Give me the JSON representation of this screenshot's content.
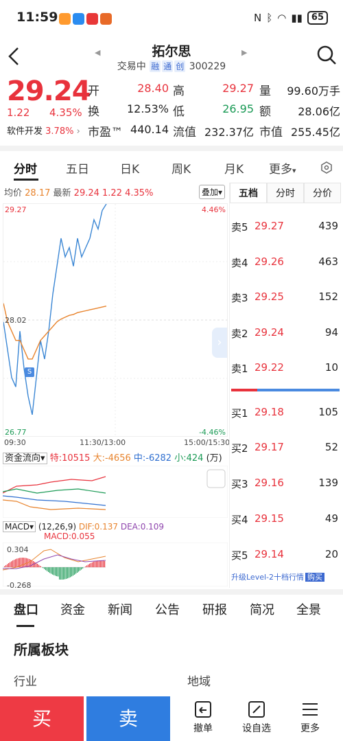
{
  "status_bar": {
    "time": "11:59",
    "battery": "65"
  },
  "header": {
    "stock_name": "拓尔思",
    "trade_status": "交易中",
    "tags": [
      "融",
      "通",
      "创"
    ],
    "code": "300229"
  },
  "quote": {
    "price": "29.24",
    "change": "1.22",
    "change_pct": "4.35%",
    "sector_name": "软件开发",
    "sector_pct": "3.78%",
    "fields": [
      {
        "label": "开",
        "value": "28.40",
        "color": "red"
      },
      {
        "label": "高",
        "value": "29.27",
        "color": "red"
      },
      {
        "label": "量",
        "value": "99.60万手",
        "color": "black"
      },
      {
        "label": "换",
        "value": "12.53%",
        "color": "black"
      },
      {
        "label": "低",
        "value": "26.95",
        "color": "green"
      },
      {
        "label": "额",
        "value": "28.06亿",
        "color": "black"
      },
      {
        "label": "市盈™",
        "value": "440.14",
        "color": "black"
      },
      {
        "label": "流值",
        "value": "232.37亿",
        "color": "black"
      },
      {
        "label": "市值",
        "value": "255.45亿",
        "color": "black"
      }
    ]
  },
  "chart_tabs": [
    "分时",
    "五日",
    "日K",
    "周K",
    "月K",
    "更多"
  ],
  "intraday": {
    "avg_label": "均价",
    "avg": "28.17",
    "latest_label": "最新",
    "latest": "29.24",
    "chg": "1.22",
    "pct": "4.35%",
    "overlay_btn": "叠加▾",
    "y_top": "29.27",
    "y_mid": "28.02",
    "y_bot": "26.77",
    "pct_top": "4.46%",
    "pct_bot": "-4.46%",
    "x_labels": [
      "09:30",
      "11:30/13:00",
      "15:00/15:30"
    ],
    "marker": "S"
  },
  "flow": {
    "title": "资金流向",
    "items": [
      {
        "label": "特:",
        "value": "10515"
      },
      {
        "label": "大:",
        "value": "-4656"
      },
      {
        "label": "中:",
        "value": "-6282"
      },
      {
        "label": "小:",
        "value": "424"
      }
    ],
    "unit": "(万)"
  },
  "macd": {
    "title": "MACD",
    "params": "(12,26,9)",
    "dif": "DIF:0.137",
    "dea": "DEA:0.109",
    "macd": "MACD:0.055",
    "y_top": "0.304",
    "y_bot": "-0.268"
  },
  "chart_data": {
    "type": "line",
    "x_range": [
      "09:30",
      "15:00"
    ],
    "ylim": [
      26.77,
      29.27
    ],
    "series": [
      {
        "values": [
          28.0,
          27.7,
          27.4,
          27.3,
          27.9,
          27.5,
          27.2,
          27.0,
          27.4,
          27.8,
          27.6,
          27.9,
          28.3,
          28.6,
          28.9,
          28.7,
          28.8,
          28.6,
          28.9,
          28.7,
          28.8,
          28.9,
          29.1,
          29.0,
          29.2,
          29.27
        ]
      },
      {
        "values": [
          28.2,
          28.0,
          27.9,
          27.8,
          27.8,
          27.7,
          27.6,
          27.6,
          27.7,
          27.8,
          27.85,
          27.9,
          27.95,
          28.0,
          28.03,
          28.05,
          28.07,
          28.08,
          28.1,
          28.11,
          28.12,
          28.13,
          28.14,
          28.15,
          28.16,
          28.17
        ]
      }
    ]
  },
  "order_book": {
    "tabs": [
      "五档",
      "分时",
      "分价"
    ],
    "asks": [
      {
        "label": "卖5",
        "price": "29.27",
        "vol": "439"
      },
      {
        "label": "卖4",
        "price": "29.26",
        "vol": "463"
      },
      {
        "label": "卖3",
        "price": "29.25",
        "vol": "152"
      },
      {
        "label": "卖2",
        "price": "29.24",
        "vol": "94"
      },
      {
        "label": "卖1",
        "price": "29.22",
        "vol": "10"
      }
    ],
    "bids": [
      {
        "label": "买1",
        "price": "29.18",
        "vol": "105"
      },
      {
        "label": "买2",
        "price": "29.17",
        "vol": "52"
      },
      {
        "label": "买3",
        "price": "29.16",
        "vol": "139"
      },
      {
        "label": "买4",
        "price": "29.15",
        "vol": "49"
      },
      {
        "label": "买5",
        "price": "29.14",
        "vol": "20"
      }
    ],
    "level2_text": "升级Level-2十档行情",
    "level2_btn": "购买"
  },
  "bottom_tabs": [
    "盘口",
    "资金",
    "新闻",
    "公告",
    "研报",
    "简况",
    "全景"
  ],
  "section": {
    "title": "所属板块",
    "industry": "行业",
    "region": "地域"
  },
  "actions": {
    "buy": "买",
    "sell": "卖",
    "cancel": "撤单",
    "watch": "设自选",
    "more": "更多"
  }
}
